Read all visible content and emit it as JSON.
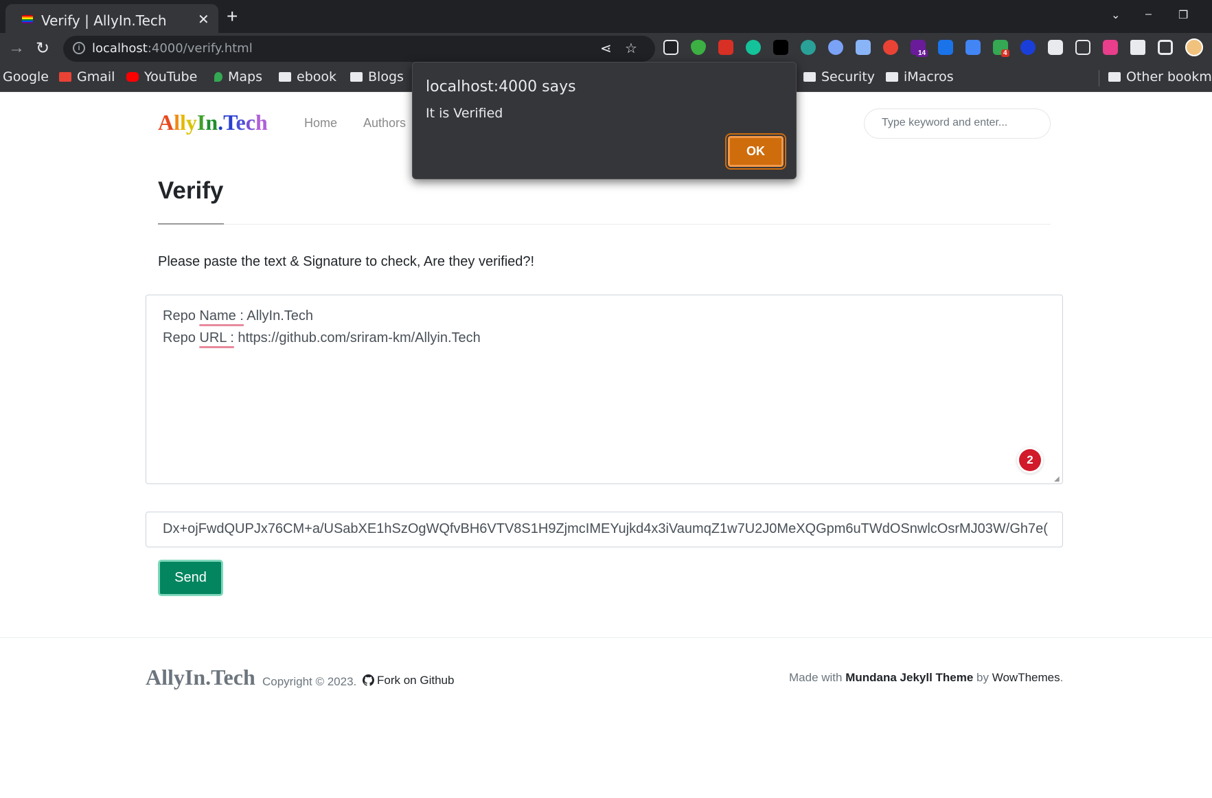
{
  "browser": {
    "tab_title": "Verify | AllyIn.Tech",
    "new_tab": "+",
    "tab_close": "✕",
    "url_host": "localhost",
    "url_path": ":4000/verify.html",
    "bookmarks": [
      {
        "label": "Google"
      },
      {
        "label": "Gmail"
      },
      {
        "label": "YouTube"
      },
      {
        "label": "Maps"
      },
      {
        "label": "ebook"
      },
      {
        "label": "Blogs"
      },
      {
        "label": "Security"
      },
      {
        "label": "iMacros"
      },
      {
        "label": "Other bookma"
      }
    ],
    "extension_badges": [
      "14",
      "4"
    ]
  },
  "site": {
    "brand_letters": [
      {
        "ch": "A",
        "color": "#e84a1f"
      },
      {
        "ch": "l",
        "color": "#f08a14"
      },
      {
        "ch": "l",
        "color": "#e5b800"
      },
      {
        "ch": "y",
        "color": "#d9c300"
      },
      {
        "ch": "I",
        "color": "#3fa02a"
      },
      {
        "ch": "n",
        "color": "#1f8f2c"
      },
      {
        "ch": ".",
        "color": "#1f3fbf"
      },
      {
        "ch": "T",
        "color": "#2a3fd0"
      },
      {
        "ch": "e",
        "color": "#4a4ed8"
      },
      {
        "ch": "c",
        "color": "#7a4fd8"
      },
      {
        "ch": "h",
        "color": "#b05fd8"
      }
    ],
    "nav": [
      "Home",
      "Authors"
    ],
    "search_placeholder": "Type keyword and enter..."
  },
  "main": {
    "title": "Verify",
    "instructions": "Please paste the text & Signature to check, Are they verified?!",
    "text_line1_a": "Repo ",
    "text_line1_b": "Name :",
    "text_line1_c": " AllyIn.Tech",
    "text_line2_a": "Repo ",
    "text_line2_b": "URL :",
    "text_line2_c": " https://github.com/sriram-km/Allyin.Tech",
    "grammarly_count": "2",
    "signature": "Dx+ojFwdQUPJx76CM+a/USabXE1hSzOgWQfvBH6VTV8S1H9ZjmcIMEYujkd4x3iVaumqZ1w7U2J0MeXQGpm6uTWdOSnwlcOsrMJ03W/Gh7e(",
    "send_label": "Send"
  },
  "footer": {
    "brand": "AllyIn.Tech",
    "copyright": "Copyright © 2023.",
    "fork": "Fork on Github",
    "made_with": "Made with ",
    "theme": "Mundana Jekyll Theme",
    "by": " by ",
    "author": "WowThemes",
    "period": "."
  },
  "dialog": {
    "title": "localhost:4000 says",
    "message": "It is Verified",
    "ok": "OK"
  }
}
